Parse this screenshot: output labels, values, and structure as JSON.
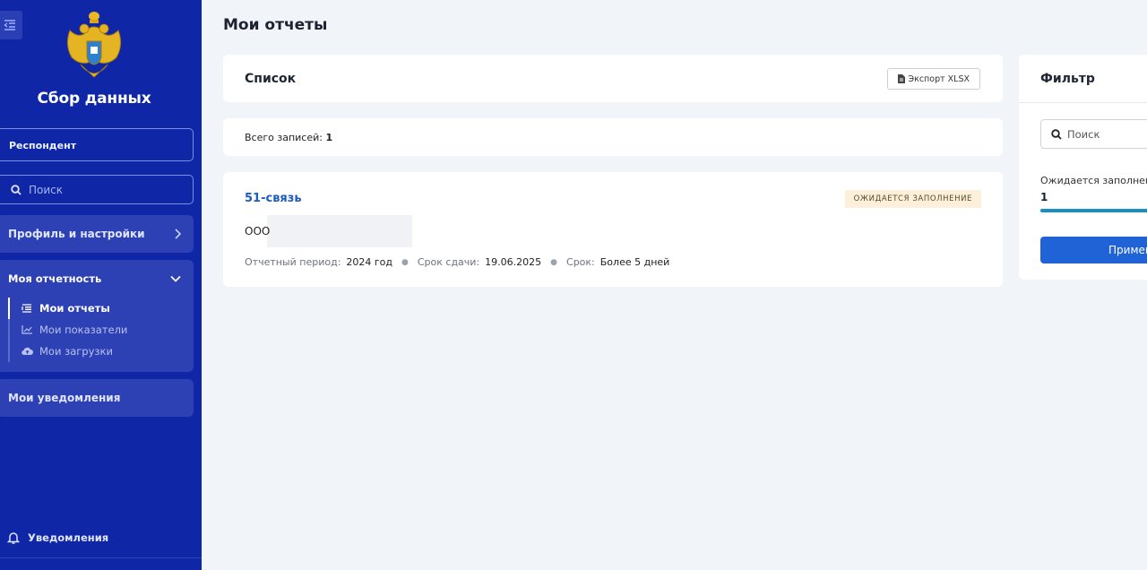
{
  "sidebar": {
    "brand": "Сбор данных",
    "respondent_label": "Респондент",
    "search_placeholder": "Поиск",
    "nav": {
      "profile": "Профиль и настройки",
      "reports": "Моя отчетность",
      "reports_items": [
        {
          "label": "Мои отчеты",
          "icon": "list-icon",
          "active": true
        },
        {
          "label": "Мои показатели",
          "icon": "chart-icon",
          "active": false
        },
        {
          "label": "Мои загрузки",
          "icon": "cloud-upload-icon",
          "active": false
        }
      ],
      "notifications": "Мои уведомления"
    },
    "bottom_notifications": "Уведомления"
  },
  "main": {
    "title": "Мои отчеты",
    "list_title": "Список",
    "export_label": "Экспорт XLSX",
    "total_label": "Всего записей:",
    "total_count": "1",
    "report": {
      "name": "51-связь",
      "status": "ОЖИДАЕТСЯ ЗАПОЛНЕНИЕ",
      "org": "ООО",
      "period_label": "Отчетный период:",
      "period_value": "2024 год",
      "due_label": "Срок сдачи:",
      "due_value": "19.06.2025",
      "term_label": "Срок:",
      "term_value": "Более 5 дней"
    }
  },
  "filter": {
    "title": "Фильтр",
    "search_placeholder": "Поиск",
    "status_label": "Ожидается заполнение",
    "status_count": "1",
    "status_progress": 1.0,
    "apply_label": "Применить"
  },
  "colors": {
    "sidebar_bg": "#0f27a6",
    "accent": "#1f63d6",
    "link": "#1d5bbf",
    "badge_bg": "#fdf0db"
  }
}
